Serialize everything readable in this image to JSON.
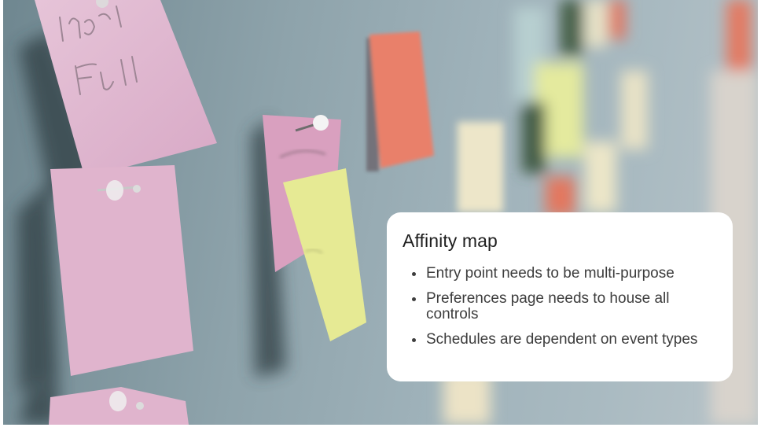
{
  "photo": {
    "subject": "sticky-notes-board",
    "handwritten_notes": [
      "Impact Full"
    ]
  },
  "card": {
    "title": "Affinity map",
    "items": [
      "Entry point needs to be multi-purpose",
      "Preferences page needs to house all controls",
      "Schedules are dependent on event types"
    ]
  }
}
